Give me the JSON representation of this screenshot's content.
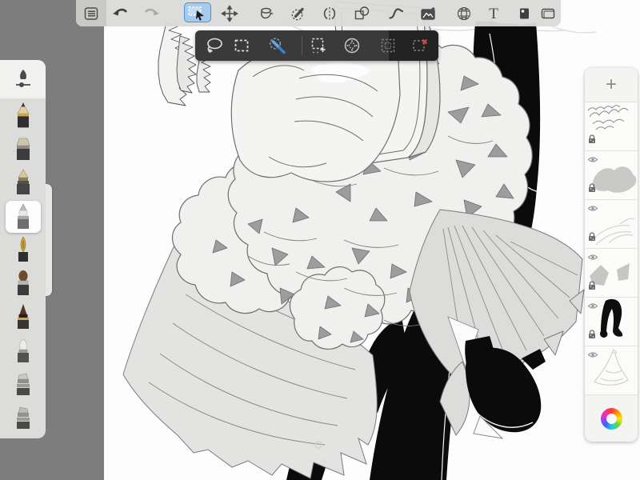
{
  "app": {
    "accent_blue": "#4d8fd2",
    "toolbar_bg": "#dadad8",
    "dark_bar_bg": "#3a3a3a",
    "workspace_bg": "#7d7d7d"
  },
  "top_toolbar": {
    "text_tool_glyph": "T",
    "tools": [
      {
        "name": "menu",
        "state": "normal"
      },
      {
        "name": "undo",
        "state": "enabled"
      },
      {
        "name": "redo",
        "state": "disabled"
      },
      {
        "name": "selection",
        "state": "active"
      },
      {
        "name": "transform",
        "state": "normal"
      },
      {
        "name": "fill",
        "state": "normal"
      },
      {
        "name": "eraser",
        "state": "normal"
      },
      {
        "name": "symmetry",
        "state": "normal"
      },
      {
        "name": "shapes",
        "state": "normal"
      },
      {
        "name": "stroke",
        "state": "normal"
      },
      {
        "name": "import-image",
        "state": "normal"
      },
      {
        "name": "perspective",
        "state": "normal"
      },
      {
        "name": "text",
        "state": "normal"
      },
      {
        "name": "layer-editor",
        "state": "normal"
      },
      {
        "name": "canvas",
        "state": "normal"
      }
    ]
  },
  "selection_toolbar": {
    "tools": [
      {
        "name": "lasso",
        "state": "normal"
      },
      {
        "name": "rectangle-select",
        "state": "normal"
      },
      {
        "name": "magic-wand",
        "state": "active"
      },
      {
        "name": "add-to-selection",
        "state": "normal"
      },
      {
        "name": "nudge",
        "state": "normal"
      },
      {
        "name": "invert-selection",
        "state": "disabled"
      },
      {
        "name": "deselect",
        "state": "disabled"
      }
    ],
    "deselect_x_color": "#d84a3a"
  },
  "left_panel": {
    "selected_index": 4,
    "brushes": [
      {
        "name": "brush-size-slider"
      },
      {
        "name": "pencil"
      },
      {
        "name": "flat-shader"
      },
      {
        "name": "airbrush"
      },
      {
        "name": "marker"
      },
      {
        "name": "ink-pen"
      },
      {
        "name": "round-brush"
      },
      {
        "name": "pointed-brush"
      },
      {
        "name": "soft-brush"
      },
      {
        "name": "chisel-marker"
      },
      {
        "name": "chisel-marker-2"
      }
    ]
  },
  "layers_panel": {
    "add_button_glyph": "+",
    "layers": [
      {
        "thumb": "hair-sketch",
        "visible": false,
        "locked": true
      },
      {
        "thumb": "gray-blob",
        "visible": true,
        "locked": true
      },
      {
        "thumb": "light-ruffles",
        "visible": true,
        "locked": true
      },
      {
        "thumb": "skirt-shadows",
        "visible": true,
        "locked": true
      },
      {
        "thumb": "black-legs",
        "visible": true,
        "locked": true
      },
      {
        "thumb": "dress-lineart",
        "visible": true,
        "locked": false
      }
    ],
    "color_button": "color-wheel"
  },
  "artwork": {
    "alt": "Black-and-white line art of a dancing couple: ruffled dress with gray shading and a partner in black"
  }
}
